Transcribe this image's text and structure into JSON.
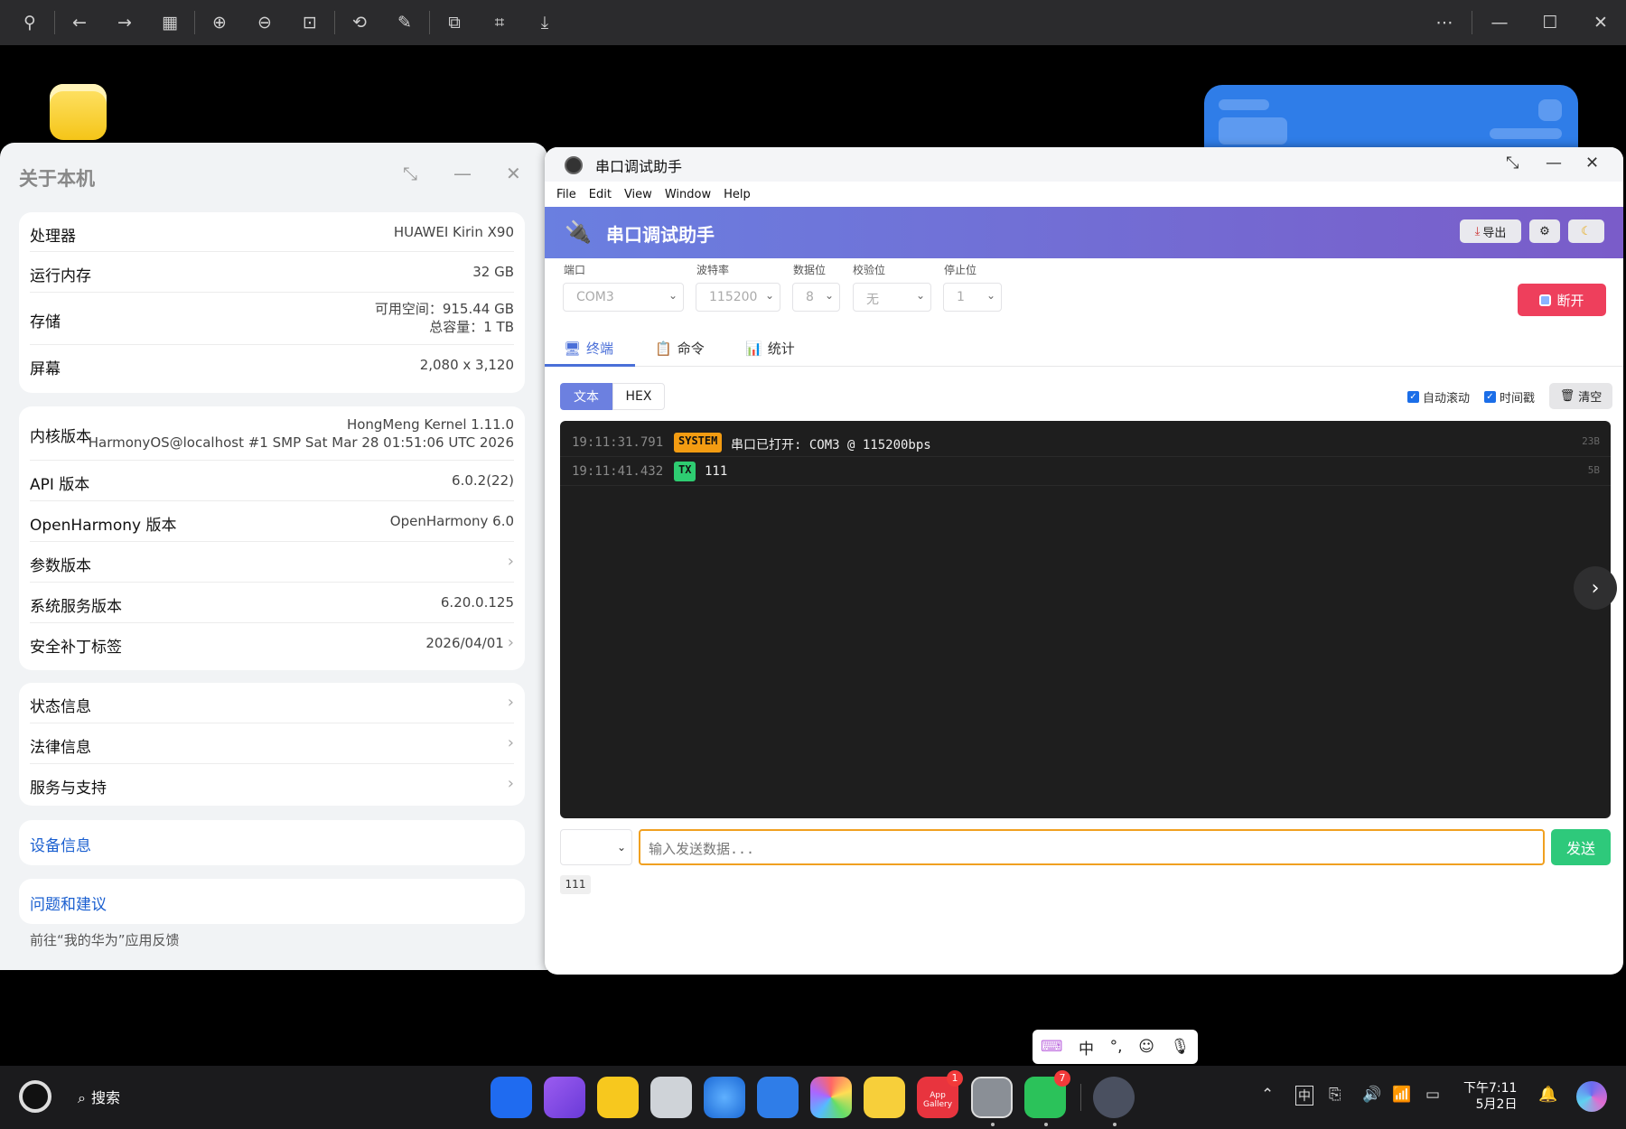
{
  "viewer_toolbar": {
    "icons": [
      "pin-icon",
      "back-icon",
      "forward-icon",
      "grid-icon",
      "zoom-in-icon",
      "zoom-out-icon",
      "actual-size-icon",
      "rotate-icon",
      "edit-icon",
      "crop-icon",
      "text-extract-icon",
      "download-icon"
    ],
    "right_icons": [
      "more-icon",
      "minimize-icon",
      "maximize-icon",
      "close-icon"
    ]
  },
  "about": {
    "title": "关于本机",
    "card1": [
      {
        "label": "处理器",
        "value": "HUAWEI Kirin X90"
      },
      {
        "label": "运行内存",
        "value": "32 GB"
      },
      {
        "label": "存储",
        "value": "可用空间：915.44 GB",
        "value2": "总容量：1 TB"
      },
      {
        "label": "屏幕",
        "value": "2,080 x 3,120"
      }
    ],
    "card2": [
      {
        "label": "内核版本",
        "value": "HongMeng Kernel 1.11.0",
        "value2": "HarmonyOS@localhost #1 SMP Sat Mar 28 01:51:06 UTC 2026"
      },
      {
        "label": "API 版本",
        "value": "6.0.2(22)"
      },
      {
        "label": "OpenHarmony 版本",
        "value": "OpenHarmony 6.0"
      },
      {
        "label": "参数版本",
        "value": ""
      },
      {
        "label": "系统服务版本",
        "value": "6.20.0.125"
      },
      {
        "label": "安全补丁标签",
        "value": "2026/04/01"
      }
    ],
    "card3": [
      {
        "label": "状态信息"
      },
      {
        "label": "法律信息"
      },
      {
        "label": "服务与支持"
      }
    ],
    "device_info": "设备信息",
    "feedback": "问题和建议",
    "footer": "前往“我的华为”应用反馈"
  },
  "serial": {
    "window_title": "串口调试助手",
    "menu": [
      "File",
      "Edit",
      "View",
      "Window",
      "Help"
    ],
    "header_title": "串口调试助手",
    "export_label": "导出",
    "port_label": "端口",
    "port_value": "COM3",
    "baud_label": "波特率",
    "baud_value": "115200",
    "databits_label": "数据位",
    "databits_value": "8",
    "parity_label": "校验位",
    "parity_value": "无",
    "stopbits_label": "停止位",
    "stopbits_value": "1",
    "disconnect_label": "断开",
    "tabs": [
      "终端",
      "命令",
      "统计"
    ],
    "mode_text": "文本",
    "mode_hex": "HEX",
    "autoscroll_label": "自动滚动",
    "timestamp_label": "时间戳",
    "clear_label": "清空",
    "log": [
      {
        "time": "19:11:31.791",
        "tag": "SYSTEM",
        "text": "串口已打开: COM3 @ 115200bps",
        "size": "23B"
      },
      {
        "time": "19:11:41.432",
        "tag": "TX",
        "text": "111",
        "size": "5B"
      }
    ],
    "input_placeholder": "输入发送数据...",
    "send_label": "发送",
    "history_item": "111"
  },
  "ime": {
    "chinese": "中",
    "punct": "°,"
  },
  "taskbar": {
    "search_label": "搜索",
    "apps": [
      "grid-apps-icon",
      "gallery-app-icon",
      "files-app-icon",
      "trash-icon",
      "browser-icon",
      "mail-icon",
      "photos-icon",
      "notes-icon",
      "app-gallery-icon",
      "settings-icon",
      "wechat-icon",
      "devtools-icon"
    ],
    "appgallery_badge": "1",
    "wechat_badge": "7",
    "appgallery_text": "App Gallery",
    "ime_indicator": "中",
    "time": "下午7:11",
    "date": "5月2日"
  }
}
